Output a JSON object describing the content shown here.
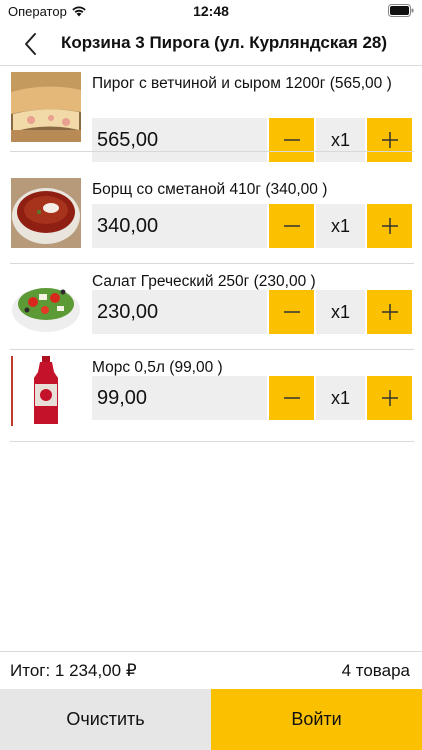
{
  "status_bar": {
    "carrier": "Оператор",
    "time": "12:48"
  },
  "nav": {
    "title": "Корзина 3 Пирога (ул. Курляндская 28)"
  },
  "items": [
    {
      "name": "Пирог с ветчиной и сыром 1200г (565,00 )",
      "price": "565,00",
      "quantity": "x1",
      "image": "pie-photo"
    },
    {
      "name": "Борщ со сметаной 410г (340,00 )",
      "price": "340,00",
      "quantity": "x1",
      "image": "borscht-photo"
    },
    {
      "name": "Салат Греческий 250г (230,00 )",
      "price": "230,00",
      "quantity": "x1",
      "image": "salad-photo"
    },
    {
      "name": "Морс 0,5л (99,00 )",
      "price": "99,00",
      "quantity": "x1",
      "image": "juice-bottle-photo"
    }
  ],
  "summary": {
    "total": "Итог: 1 234,00 ₽",
    "count": "4 товара"
  },
  "actions": {
    "clear_label": "Очистить",
    "login_label": "Войти"
  },
  "colors": {
    "accent": "#fbc000",
    "field_bg": "#eeeeee",
    "clear_bg": "#e6e6e6"
  },
  "icons": {
    "back": "chevron-left-icon",
    "minus": "minus-icon",
    "plus": "plus-icon"
  }
}
